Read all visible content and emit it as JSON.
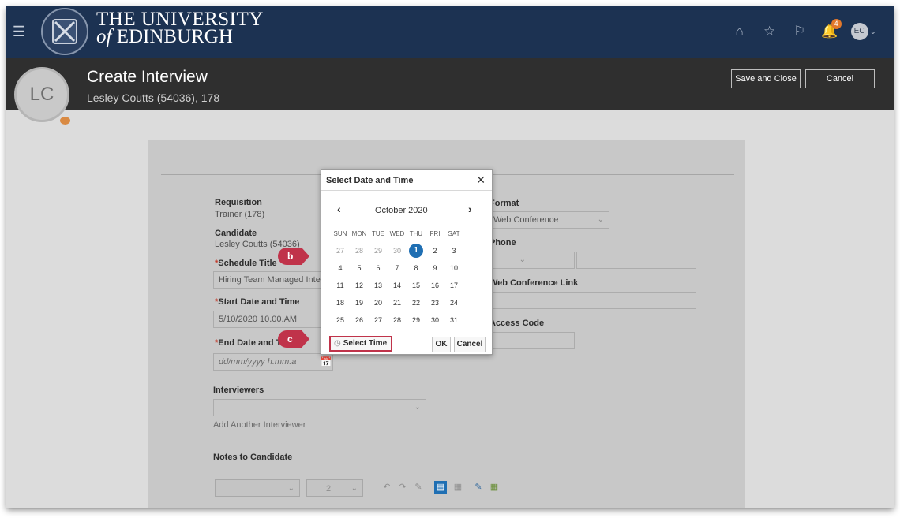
{
  "brand": {
    "line1": "THE UNIVERSITY",
    "line2_prefix": "of",
    "line2": "EDINBURGH"
  },
  "topbar": {
    "notification_count": "4",
    "user_initials": "EC"
  },
  "header": {
    "avatar_initials": "LC",
    "title": "Create Interview",
    "subtitle": "Lesley Coutts (54036), 178",
    "save_close": "Save and Close",
    "cancel": "Cancel"
  },
  "form": {
    "requisition_label": "Requisition",
    "requisition_value": "Trainer (178)",
    "candidate_label": "Candidate",
    "candidate_value": "Lesley Coutts (54036)",
    "schedule_title_label": "Schedule Title",
    "schedule_title_value": "Hiring Team Managed Inte",
    "start_label": "Start Date and Time",
    "start_value": "5/10/2020 10.00.AM",
    "end_label": "End Date and Ti",
    "end_placeholder": "dd/mm/yyyy h.mm.a",
    "interviewers_label": "Interviewers",
    "add_interviewer": "Add Another Interviewer",
    "notes_label": "Notes to Candidate",
    "format_label": "Format",
    "format_value": "Web Conference",
    "phone_label": "Phone",
    "web_link_label": "Web Conference Link",
    "access_code_label": "Access Code",
    "required_mark": "*"
  },
  "toolbar": {
    "font_size": "2"
  },
  "dialog": {
    "title": "Select Date and Time",
    "month": "October 2020",
    "days": [
      "SUN",
      "MON",
      "TUE",
      "WED",
      "THU",
      "FRI",
      "SAT"
    ],
    "weeks": [
      [
        "27",
        "28",
        "29",
        "30",
        "1",
        "2",
        "3"
      ],
      [
        "4",
        "5",
        "6",
        "7",
        "8",
        "9",
        "10"
      ],
      [
        "11",
        "12",
        "13",
        "14",
        "15",
        "16",
        "17"
      ],
      [
        "18",
        "19",
        "20",
        "21",
        "22",
        "23",
        "24"
      ],
      [
        "25",
        "26",
        "27",
        "28",
        "29",
        "30",
        "31"
      ]
    ],
    "selected_day": "1",
    "select_time": "Select Time",
    "ok": "OK",
    "cancel": "Cancel"
  },
  "callouts": {
    "b": "b",
    "c": "c"
  },
  "colors": {
    "topbar": "#1c3252",
    "header": "#2f2f2f",
    "accent": "#c0334a",
    "selected": "#1f6fb3"
  }
}
